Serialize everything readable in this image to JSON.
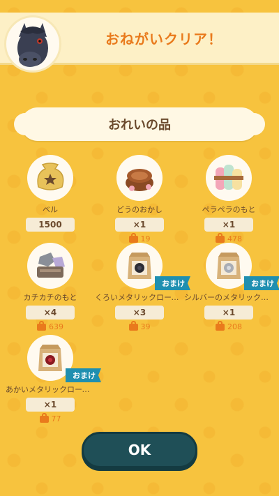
{
  "header": {
    "title": "おねがいクリア！"
  },
  "reward_banner": {
    "label": "おれいの品"
  },
  "items": [
    {
      "name": "ベル",
      "qty": "1500",
      "price": null,
      "omake": false,
      "icon": "bell-bag-icon"
    },
    {
      "name": "どうのおかし",
      "qty": "×1",
      "price": "19",
      "omake": false,
      "icon": "candy-icon"
    },
    {
      "name": "ペラペラのもと",
      "qty": "×1",
      "price": "478",
      "omake": false,
      "icon": "fabric-rolls-icon"
    },
    {
      "name": "カチカチのもと",
      "qty": "×4",
      "price": "639",
      "omake": false,
      "icon": "stone-materials-icon"
    },
    {
      "name": "くろいメタリックローズのタネ",
      "qty": "×3",
      "price": "39",
      "omake": true,
      "omake_label": "おまけ",
      "icon": "black-rose-seed-icon"
    },
    {
      "name": "シルバーのメタリックロー…",
      "qty": "×1",
      "price": "208",
      "omake": true,
      "omake_label": "おまけ",
      "icon": "silver-rose-seed-icon"
    },
    {
      "name": "あかいメタリックローズのタネ",
      "qty": "×1",
      "price": "77",
      "omake": true,
      "omake_label": "おまけ",
      "icon": "red-rose-seed-icon"
    }
  ],
  "ok_button": {
    "label": "OK"
  },
  "colors": {
    "background": "#f7c33e",
    "accent": "#e97a1c",
    "omake_badge": "#1f8fb0",
    "button": "#1f4f57"
  }
}
